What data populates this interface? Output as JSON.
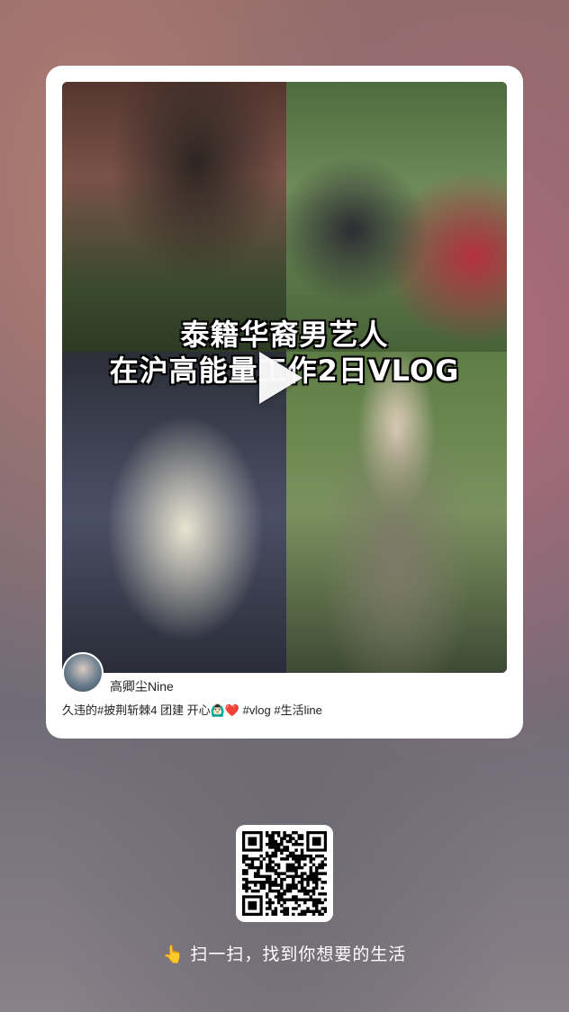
{
  "post": {
    "cover_title_line1": "泰籍华裔男艺人",
    "cover_title_line2": "在沪高能量工作2日VLOG",
    "author_name": "高卿尘Nine",
    "description": "久违的#披荆斩棘4 团建 开心🙆🏻‍♂️❤️ #vlog #生活line"
  },
  "share": {
    "hand_emoji": "👆",
    "scan_text": "扫一扫，找到你想要的生活"
  },
  "icons": {
    "play": "play-icon",
    "qr": "qr-code"
  }
}
